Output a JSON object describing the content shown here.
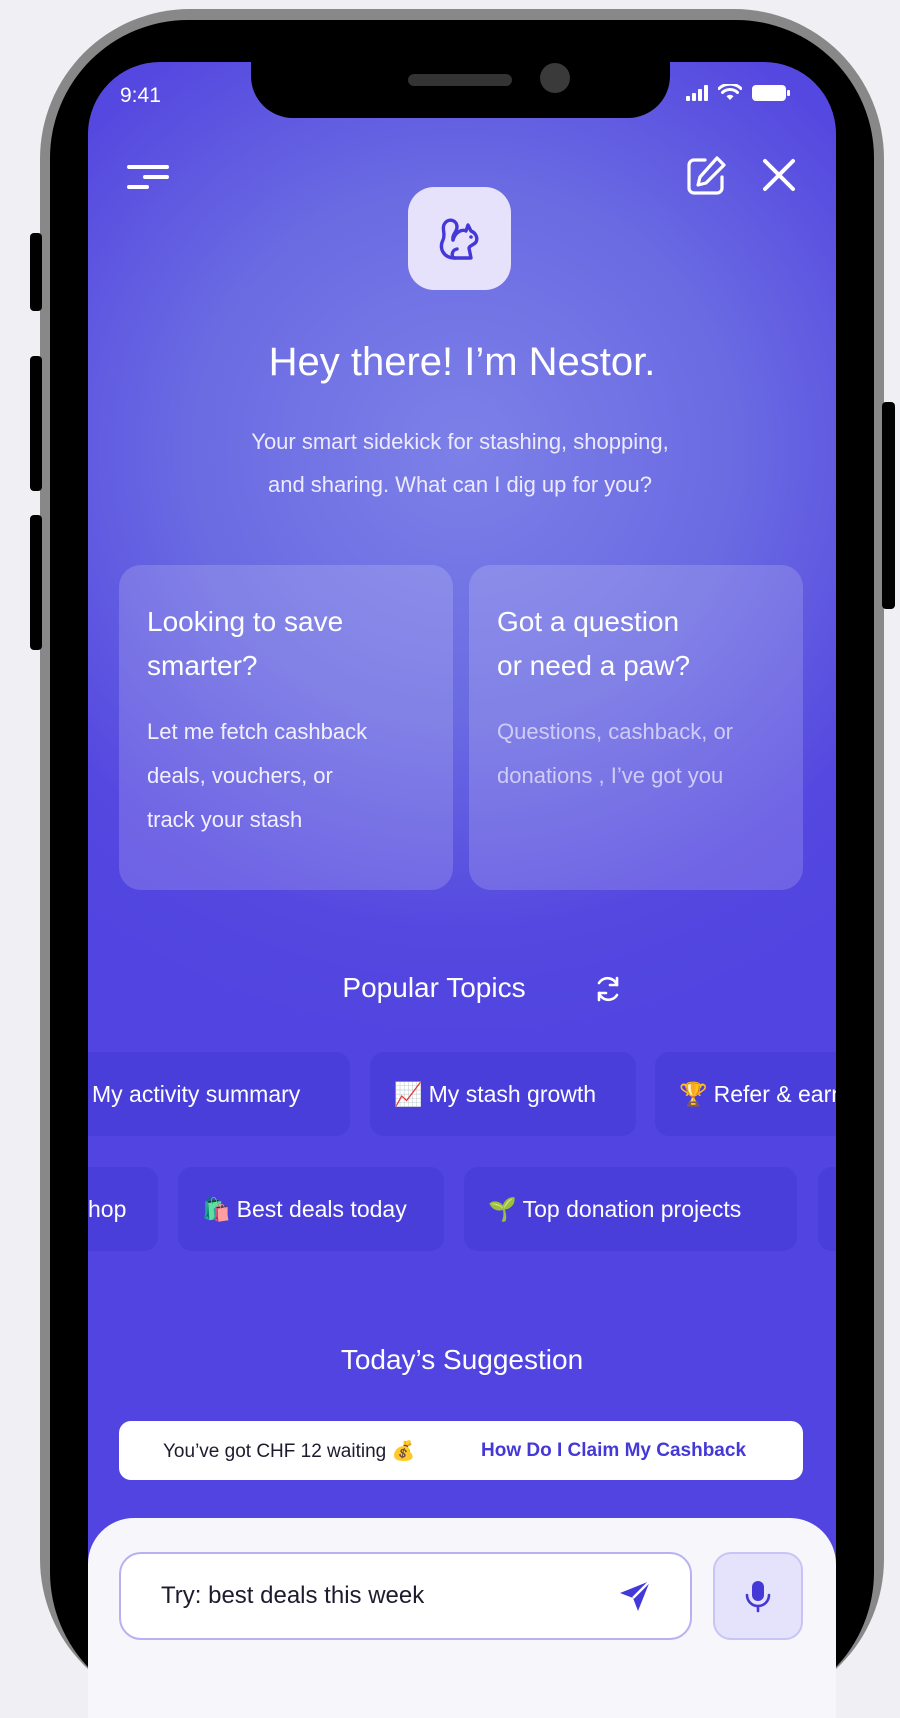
{
  "status_bar": {
    "time": "9:41"
  },
  "header": {
    "title": "Hey there! I’m Nestor.",
    "subtitle_line1": "Your smart sidekick for stashing, shopping,",
    "subtitle_line2": "and sharing. What can I dig up for you?"
  },
  "cards": [
    {
      "title_line1": "Looking to save",
      "title_line2": "smarter?",
      "body_line1": "Let me fetch cashback",
      "body_line2": "deals, vouchers, or",
      "body_line3": "track your stash"
    },
    {
      "title_line1": "Got a question",
      "title_line2": "or need a paw?",
      "body_line1": "Questions, cashback, or",
      "body_line2": "donations , I’ve got you"
    }
  ],
  "popular_topics": {
    "title": "Popular Topics",
    "row1": [
      {
        "emoji": "",
        "label": "My activity summary"
      },
      {
        "emoji": "📈",
        "label": "My stash growth"
      },
      {
        "emoji": "🏆",
        "label": "Refer & earn"
      }
    ],
    "row2": [
      {
        "emoji": "",
        "label": "hop"
      },
      {
        "emoji": "🛍️",
        "label": "Best deals today"
      },
      {
        "emoji": "🌱",
        "label": "Top donation projects"
      },
      {
        "emoji": "",
        "label": ""
      }
    ]
  },
  "suggestion": {
    "title": "Today’s Suggestion",
    "text": "You’ve got CHF 12 waiting 💰",
    "link": "How Do I Claim My Cashback"
  },
  "chat": {
    "placeholder": "Try: best deals this week"
  },
  "colors": {
    "accent": "#4438d8",
    "screen_background": "#5548e0",
    "chip": "#4a3edb"
  },
  "icons": {
    "menu": "menu-icon",
    "edit": "edit-icon",
    "close": "close-icon",
    "logo": "squirrel-icon",
    "refresh": "refresh-icon",
    "send": "send-icon",
    "mic": "mic-icon"
  }
}
